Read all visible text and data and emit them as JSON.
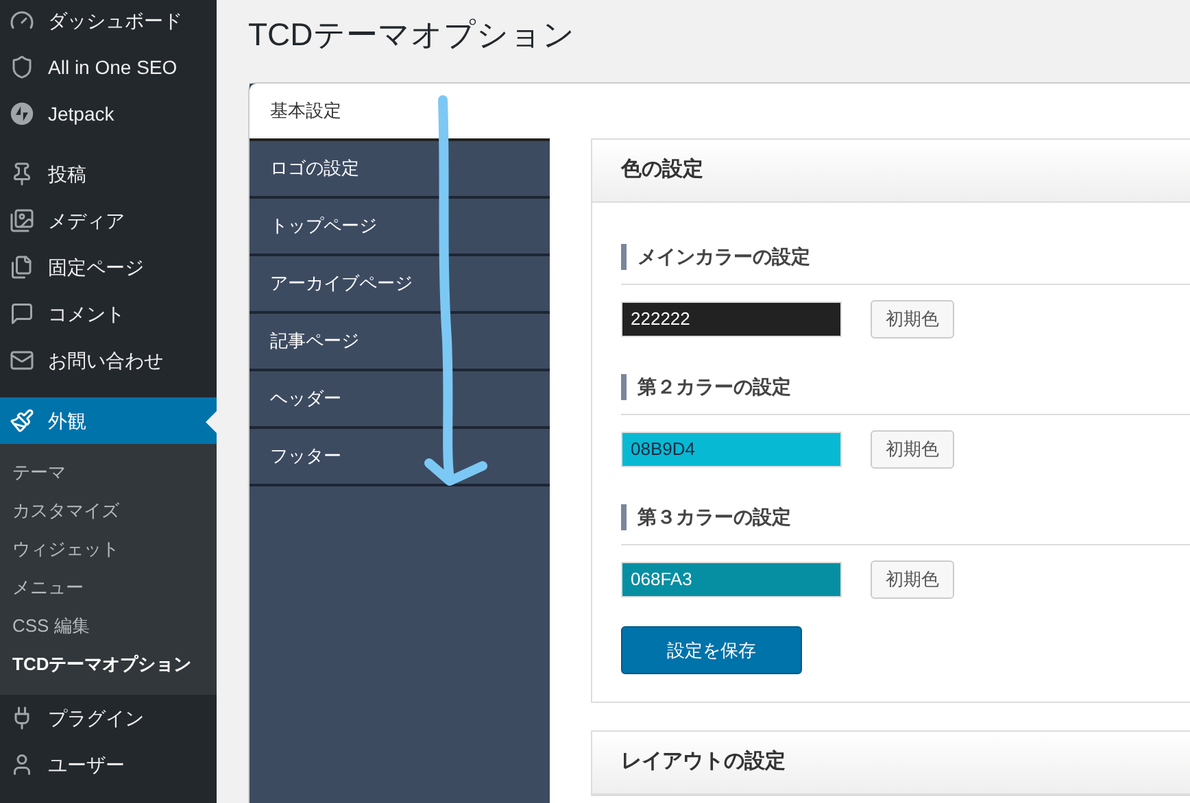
{
  "sidebar": {
    "groups": [
      {
        "items": [
          {
            "label": "ダッシュボード",
            "selected": false
          },
          {
            "label": "All in One SEO",
            "selected": false
          },
          {
            "label": "Jetpack",
            "selected": false
          }
        ]
      },
      {
        "items": [
          {
            "label": "投稿",
            "selected": false
          },
          {
            "label": "メディア",
            "selected": false
          },
          {
            "label": "固定ページ",
            "selected": false
          },
          {
            "label": "コメント",
            "selected": false
          },
          {
            "label": "お問い合わせ",
            "selected": false
          }
        ]
      },
      {
        "items": [
          {
            "label": "外観",
            "selected": true,
            "children": [
              {
                "label": "テーマ",
                "selected": false
              },
              {
                "label": "カスタマイズ",
                "selected": false
              },
              {
                "label": "ウィジェット",
                "selected": false
              },
              {
                "label": "メニュー",
                "selected": false
              },
              {
                "label": "CSS 編集",
                "selected": false
              },
              {
                "label": "TCDテーマオプション",
                "selected": true
              }
            ]
          },
          {
            "label": "プラグイン",
            "selected": false
          },
          {
            "label": "ユーザー",
            "selected": false
          }
        ]
      }
    ]
  },
  "page": {
    "title": "TCDテーマオプション"
  },
  "tabs": [
    {
      "label": "基本設定",
      "selected": true
    },
    {
      "label": "ロゴの設定",
      "selected": false
    },
    {
      "label": "トップページ",
      "selected": false
    },
    {
      "label": "アーカイブページ",
      "selected": false
    },
    {
      "label": "記事ページ",
      "selected": false
    },
    {
      "label": "ヘッダー",
      "selected": false
    },
    {
      "label": "フッター",
      "selected": false
    }
  ],
  "cards": [
    {
      "title": "色の設定",
      "settings": [
        {
          "heading": "メインカラーの設定",
          "value": "222222",
          "color": "#222222",
          "reset_button": "初期色"
        },
        {
          "heading": "第２カラーの設定",
          "value": "08B9D4",
          "color": "#08b9d4",
          "reset_button": "初期色"
        },
        {
          "heading": "第３カラーの設定",
          "value": "068FA3",
          "color": "#068fa3",
          "reset_button": "初期色"
        }
      ],
      "save_button": "設定を保存"
    },
    {
      "title": "レイアウトの設定"
    }
  ]
}
